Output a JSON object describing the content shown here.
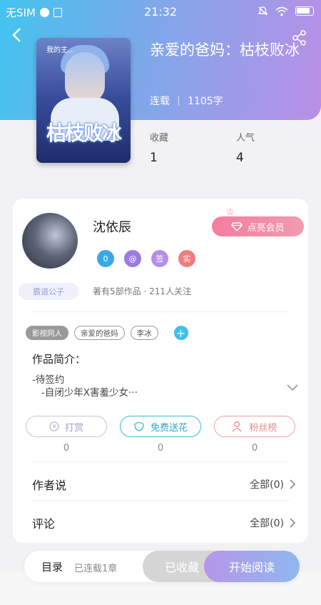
{
  "status_bar": {
    "carrier": "无SIM",
    "time": "21:32"
  },
  "book": {
    "title": "亲爱的爸妈：枯枝败冰",
    "status": "连载",
    "word_count": "1105字",
    "cover_title": "枯枝败冰",
    "cover_tag": "我的主..."
  },
  "stats": {
    "favorites_label": "收藏",
    "favorites_value": "1",
    "popularity_label": "人气",
    "popularity_value": "4"
  },
  "author": {
    "name": "沈依辰",
    "vip_button": "点亮会员",
    "title_label": "霸道公子",
    "works_info": "著有5部作品 · 211人关注",
    "badges": [
      "0",
      "@",
      "签",
      "实"
    ]
  },
  "tags": [
    "影视同人",
    "亲爱的爸妈",
    "李冰"
  ],
  "add_tag": "+",
  "intro": {
    "heading": "作品简介：",
    "text": "-待签约\n   -自闭少年X害羞少女···"
  },
  "actions": [
    {
      "label": "打赏",
      "count": "0",
      "color": "#b7b7c9"
    },
    {
      "label": "免费送花",
      "count": "0",
      "color": "#3ab9d8"
    },
    {
      "label": "粉丝榜",
      "count": "0",
      "color": "#f0a2a2"
    }
  ],
  "sections": {
    "author_says_label": "作者说",
    "author_says_all": "全部(0)",
    "comments_label": "评论",
    "comments_all": "全部(0)"
  },
  "bottom_bar": {
    "toc_label": "目录",
    "toc_sub": "已连载1章",
    "collected": "已收藏",
    "start_reading": "开始阅读"
  }
}
